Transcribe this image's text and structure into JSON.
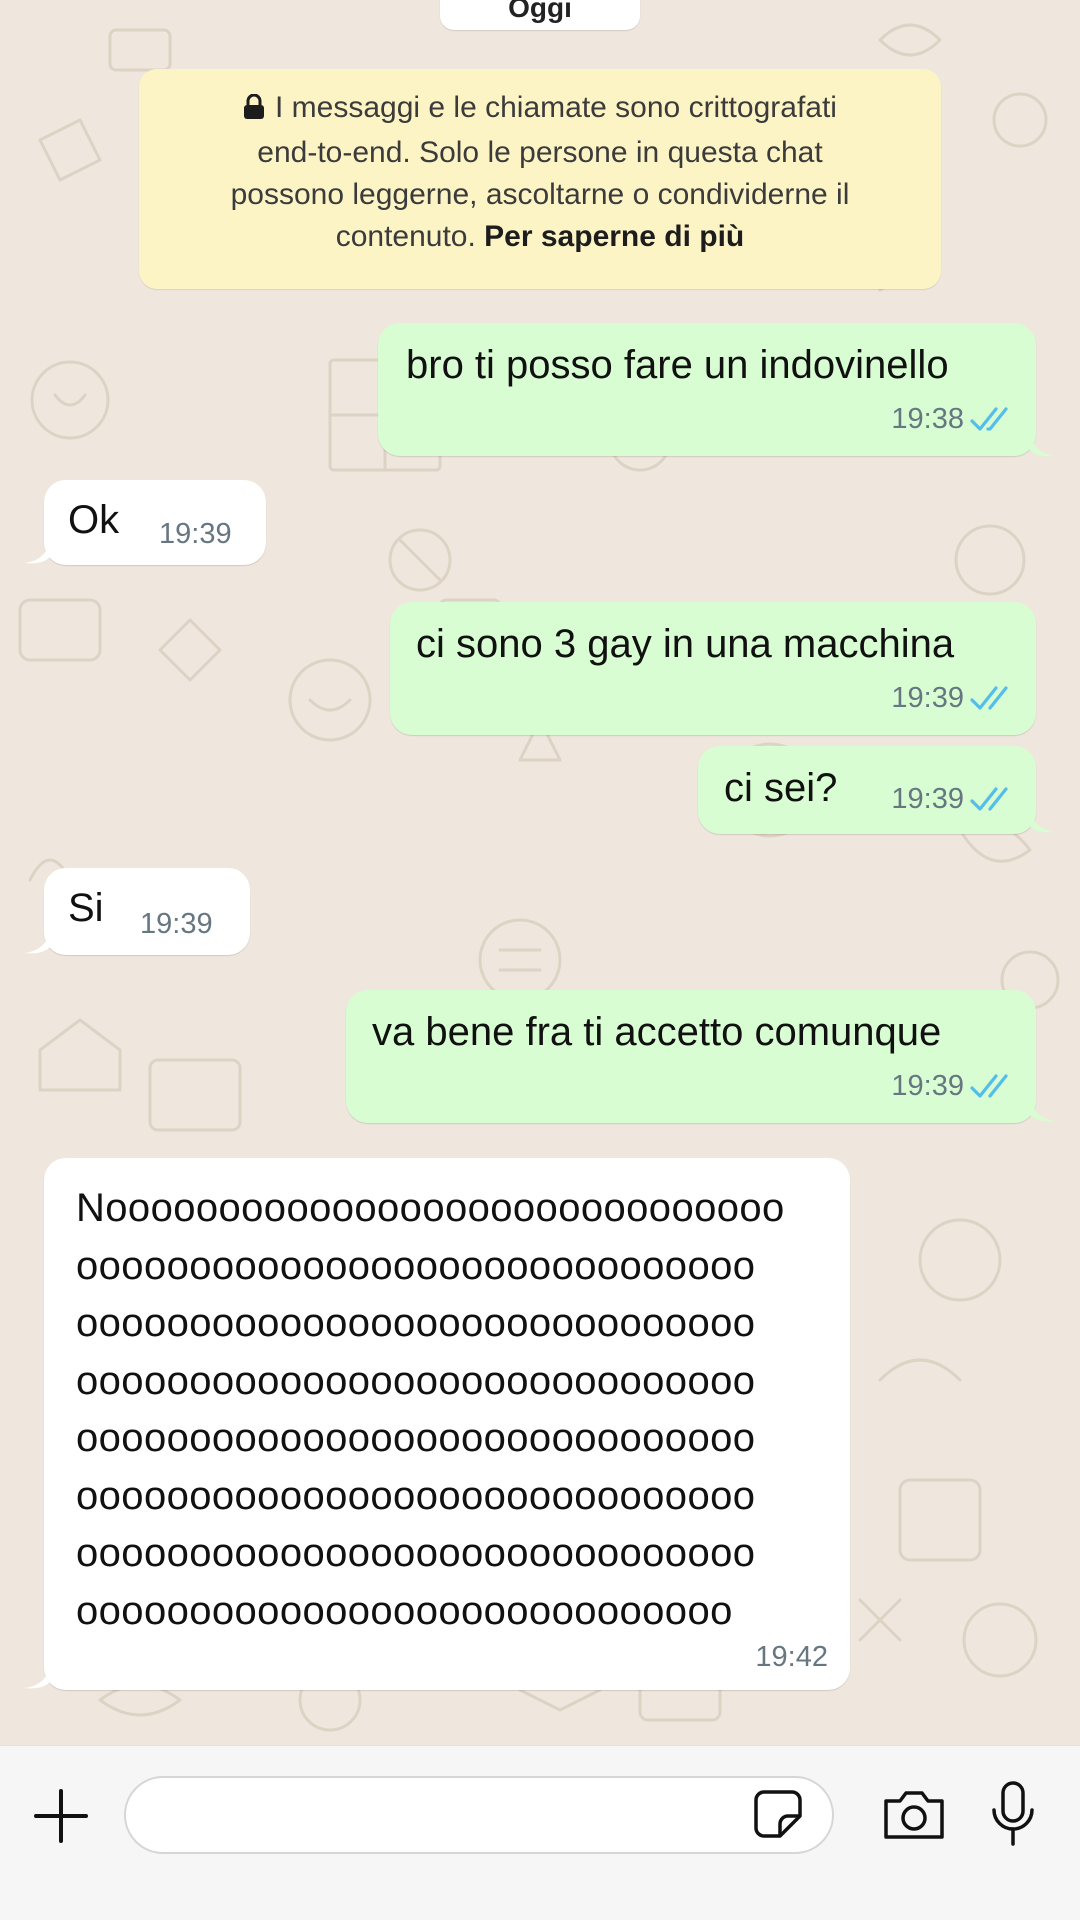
{
  "chat": {
    "date_label": "Oggi",
    "encryption_notice": {
      "line1": "I messaggi e le chiamate sono crittografati",
      "line2": "end-to-end. Solo le persone in questa chat",
      "line3": "possono leggerne, ascoltarne o condividerne il",
      "line4_prefix": "contenuto. ",
      "link": "Per saperne di più"
    },
    "messages": [
      {
        "direction": "outgoing",
        "text": "bro ti posso fare un indovinello",
        "time": "19:38",
        "status": "read"
      },
      {
        "direction": "incoming",
        "text": "Ok",
        "time": "19:39"
      },
      {
        "direction": "outgoing",
        "text": "ci sono 3 gay in una macchina",
        "time": "19:39",
        "status": "read"
      },
      {
        "direction": "outgoing",
        "text": "ci sei?",
        "time": "19:39",
        "status": "read"
      },
      {
        "direction": "incoming",
        "text": "Si",
        "time": "19:39"
      },
      {
        "direction": "outgoing",
        "text": "va bene fra ti accetto comunque",
        "time": "19:39",
        "status": "read"
      },
      {
        "direction": "incoming",
        "lines": [
          "Noooooooooooooooooooooooooooooo",
          "oooooooooooooooooooooooooooooo",
          "oooooooooooooooooooooooooooooo",
          "oooooooooooooooooooooooooooooo",
          "oooooooooooooooooooooooooooooo",
          "oooooooooooooooooooooooooooooo",
          "oooooooooooooooooooooooooooooo",
          "ooooooooooooooooooooooooooooo"
        ],
        "time": "19:42"
      }
    ]
  },
  "input_bar": {
    "message_value": "",
    "icons": [
      "plus-icon",
      "sticker-icon",
      "camera-icon",
      "microphone-icon"
    ]
  },
  "colors": {
    "chat_background": "#efe7dd",
    "outgoing_bubble": "#d9fdd3",
    "incoming_bubble": "#ffffff",
    "read_ticks": "#53bdeb",
    "encryption_notice_bg": "#fdf4c5"
  }
}
